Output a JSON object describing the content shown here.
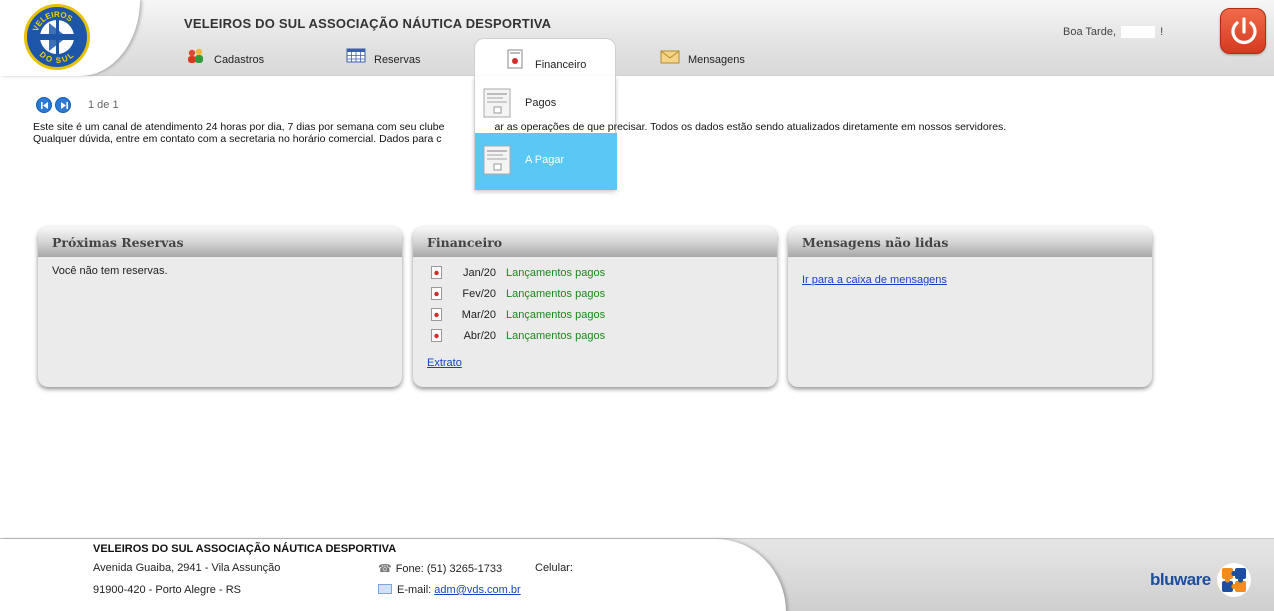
{
  "header": {
    "site_title": "VELEIROS DO SUL ASSOCIAÇÃO NÁUTICA DESPORTIVA",
    "logo_top_text": "VELEIROS",
    "logo_bottom_text": "DO SUL",
    "greeting_prefix": "Boa Tarde,",
    "greeting_suffix": "!",
    "nav": [
      {
        "label": "Cadastros"
      },
      {
        "label": "Reservas"
      },
      {
        "label": "Financeiro"
      },
      {
        "label": "Mensagens"
      }
    ]
  },
  "dropdown": {
    "items": [
      {
        "label": "Pagos"
      },
      {
        "label": "A Pagar"
      }
    ]
  },
  "pager": {
    "count": "1 de 1"
  },
  "intro": {
    "line1_a": "Este site é um canal de atendimento 24 horas por dia, 7 dias por semana com seu clube",
    "line1_b": "ar as operações de que precisar. Todos os dados estão sendo atualizados diretamente em nossos servidores.",
    "line2_a": "Qualquer dúvida, entre em contato com a secretaria no horário comercial. Dados para c"
  },
  "panels": {
    "reservas": {
      "title": "Próximas Reservas",
      "empty_text": "Você não tem reservas."
    },
    "financeiro": {
      "title": "Financeiro",
      "rows": [
        {
          "month": "Jan/20",
          "status": "Lançamentos pagos"
        },
        {
          "month": "Fev/20",
          "status": "Lançamentos pagos"
        },
        {
          "month": "Mar/20",
          "status": "Lançamentos pagos"
        },
        {
          "month": "Abr/20",
          "status": "Lançamentos pagos"
        }
      ],
      "extrato_link": "Extrato"
    },
    "mensagens": {
      "title": "Mensagens não lidas",
      "inbox_link": "Ir para a caixa de mensagens"
    }
  },
  "footer": {
    "org_name": "VELEIROS DO SUL ASSOCIAÇÃO NÁUTICA DESPORTIVA",
    "address": "Avenida Guaiba, 2941 - Vila Assunção",
    "cep_city": "91900-420 - Porto Alegre - RS",
    "phone": "Fone: (51) 3265-1733",
    "mobile_label": "Celular:",
    "email_label": "E-mail:",
    "email": "adm@vds.com.br",
    "brand": "bluware"
  },
  "colors": {
    "accent_blue": "#5ac8f5",
    "link_blue": "#1a3ecc",
    "status_green": "#1a8a1a",
    "power_red": "#d53a20"
  }
}
